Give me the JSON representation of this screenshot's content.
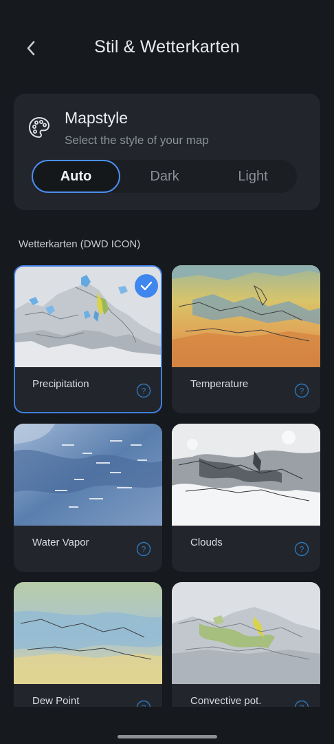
{
  "header": {
    "title": "Stil & Wetterkarten",
    "back_icon": "chevron-left-icon"
  },
  "mapstyle": {
    "icon": "palette-icon",
    "title": "Mapstyle",
    "subtitle": "Select the style of your map",
    "options": [
      "Auto",
      "Dark",
      "Light"
    ],
    "selected": "Auto"
  },
  "section": {
    "label": "Wetterkarten (DWD ICON)"
  },
  "maps": [
    {
      "label": "Precipitation",
      "selected": true
    },
    {
      "label": "Temperature",
      "selected": false
    },
    {
      "label": "Water Vapor",
      "selected": false
    },
    {
      "label": "Clouds",
      "selected": false
    },
    {
      "label": "Dew Point",
      "selected": false
    },
    {
      "label": "Convective pot.",
      "selected": false
    }
  ],
  "colors": {
    "accent": "#3f86ee",
    "background": "#16191d",
    "card": "#22262c"
  }
}
